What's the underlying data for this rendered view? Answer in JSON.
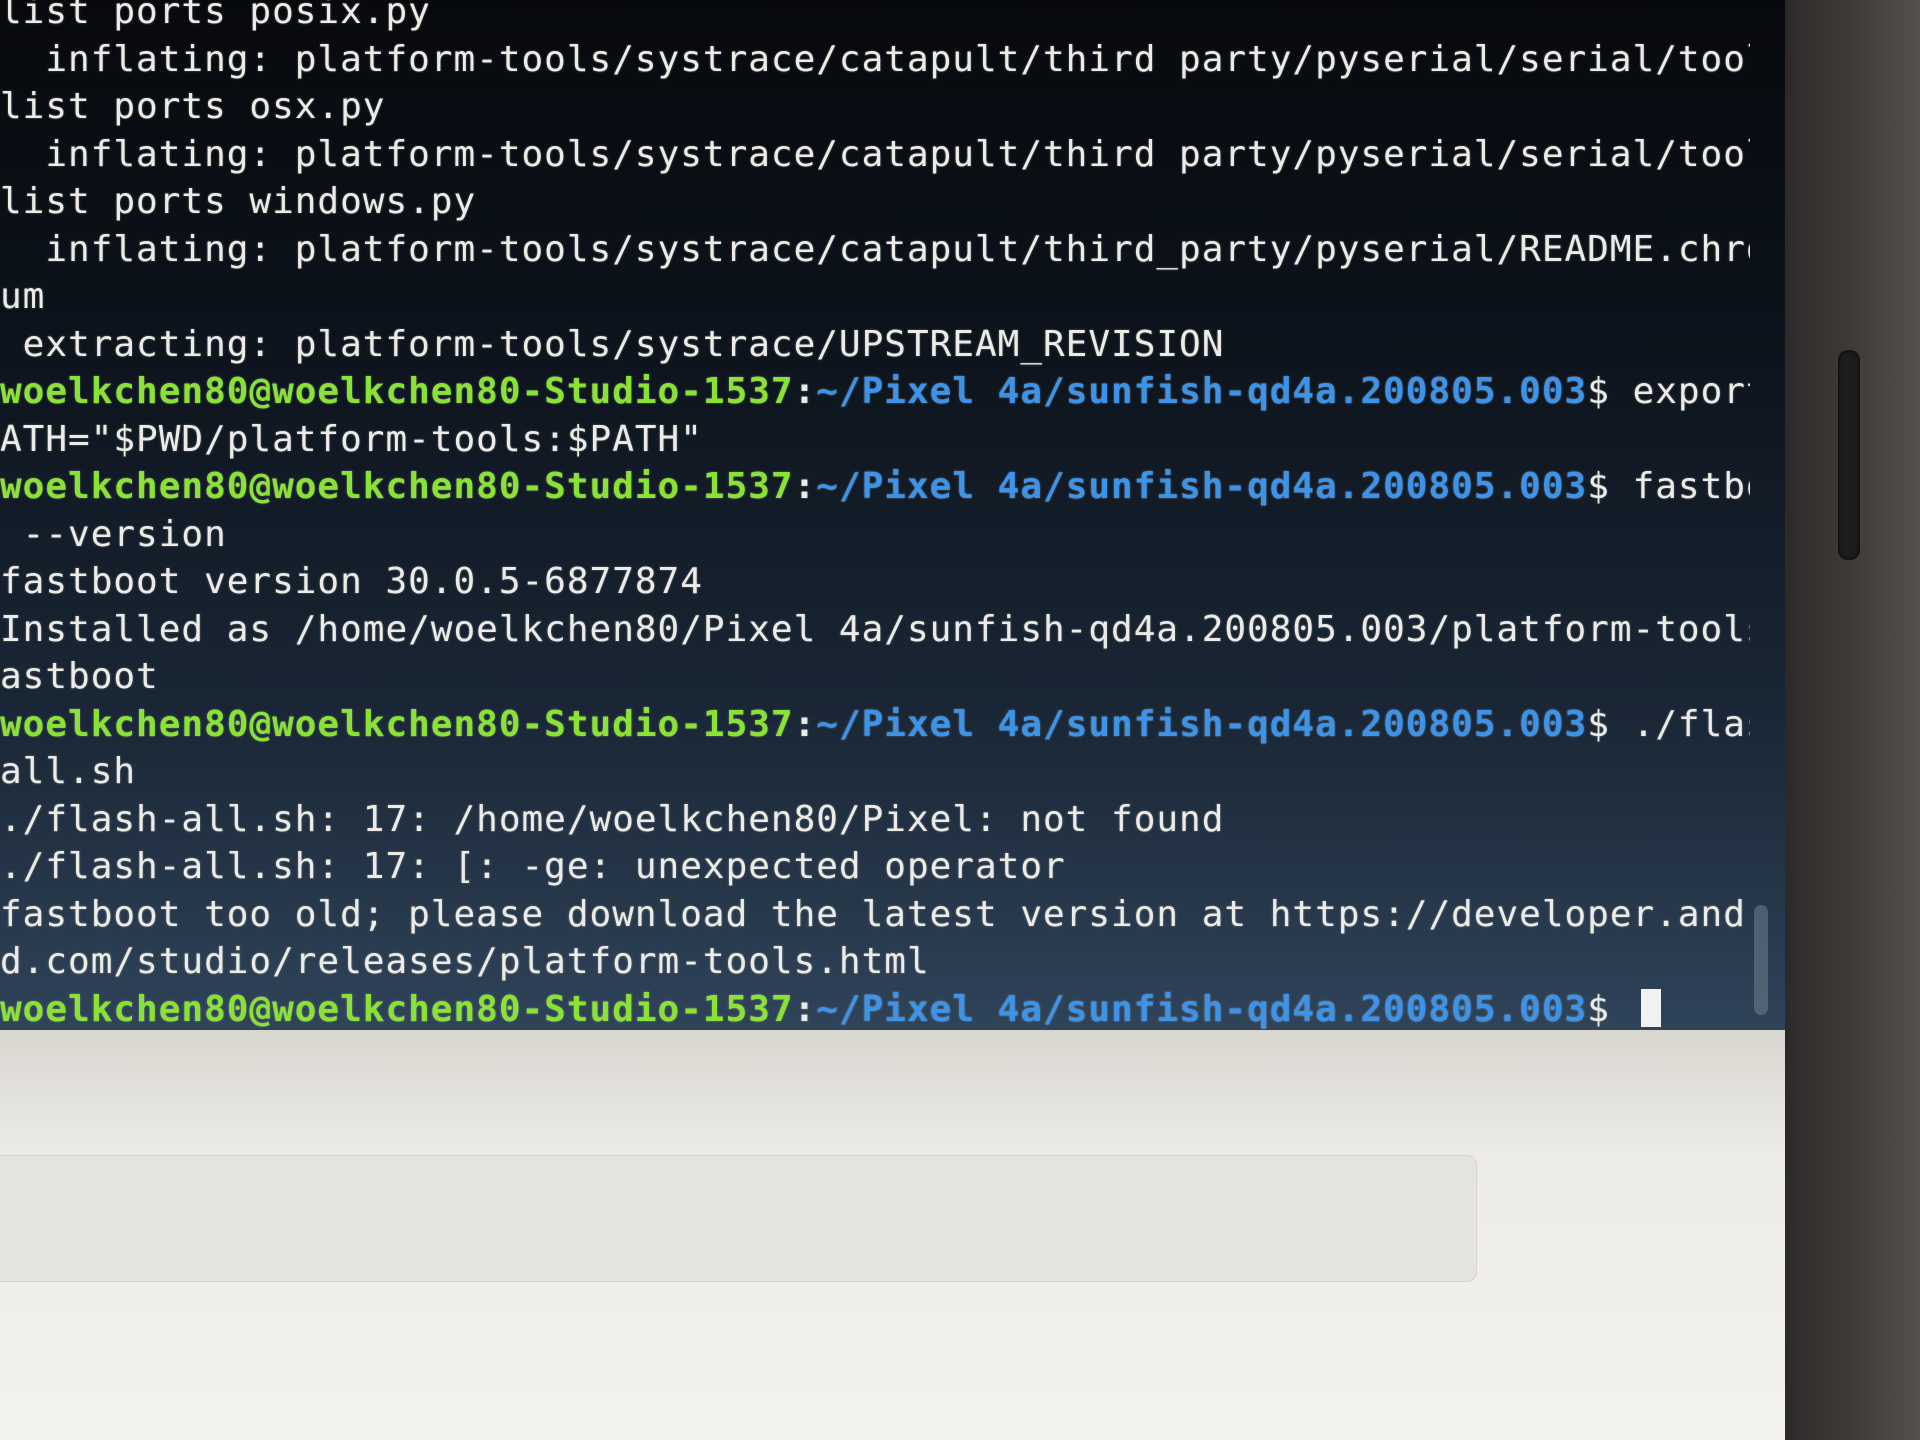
{
  "terminal": {
    "lines": [
      {
        "type": "output",
        "text": "list ports posix.py"
      },
      {
        "type": "output",
        "text": "  inflating: platform-tools/systrace/catapult/third party/pyserial/serial/tools/"
      },
      {
        "type": "output",
        "text": "list ports osx.py"
      },
      {
        "type": "output",
        "text": "  inflating: platform-tools/systrace/catapult/third party/pyserial/serial/tools/"
      },
      {
        "type": "output",
        "text": "list ports windows.py"
      },
      {
        "type": "output",
        "text": "  inflating: platform-tools/systrace/catapult/third_party/pyserial/README.chromi"
      },
      {
        "type": "output",
        "text": "um"
      },
      {
        "type": "output",
        "text": " extracting: platform-tools/systrace/UPSTREAM_REVISION"
      },
      {
        "type": "prompt",
        "user": "woelkchen80@woelkchen80-Studio-1537",
        "sep": ":",
        "path": "~/Pixel 4a/sunfish-qd4a.200805.003",
        "dollar": "$ ",
        "cmd": "export P"
      },
      {
        "type": "output",
        "text": "ATH=\"$PWD/platform-tools:$PATH\""
      },
      {
        "type": "prompt",
        "user": "woelkchen80@woelkchen80-Studio-1537",
        "sep": ":",
        "path": "~/Pixel 4a/sunfish-qd4a.200805.003",
        "dollar": "$ ",
        "cmd": "fastboot"
      },
      {
        "type": "output",
        "text": " --version"
      },
      {
        "type": "output",
        "text": "fastboot version 30.0.5-6877874"
      },
      {
        "type": "output",
        "text": "Installed as /home/woelkchen80/Pixel 4a/sunfish-qd4a.200805.003/platform-tools/f"
      },
      {
        "type": "output",
        "text": "astboot"
      },
      {
        "type": "prompt",
        "user": "woelkchen80@woelkchen80-Studio-1537",
        "sep": ":",
        "path": "~/Pixel 4a/sunfish-qd4a.200805.003",
        "dollar": "$ ",
        "cmd": "./flash-"
      },
      {
        "type": "output",
        "text": "all.sh"
      },
      {
        "type": "output",
        "text": "./flash-all.sh: 17: /home/woelkchen80/Pixel: not found"
      },
      {
        "type": "output",
        "text": "./flash-all.sh: 17: [: -ge: unexpected operator"
      },
      {
        "type": "output",
        "text": "fastboot too old; please download the latest version at https://developer.androi"
      },
      {
        "type": "output",
        "text": "d.com/studio/releases/platform-tools.html"
      },
      {
        "type": "prompt",
        "user": "woelkchen80@woelkchen80-Studio-1537",
        "sep": ":",
        "path": "~/Pixel 4a/sunfish-qd4a.200805.003",
        "dollar": "$ ",
        "cmd": "",
        "cursor": true
      }
    ]
  }
}
